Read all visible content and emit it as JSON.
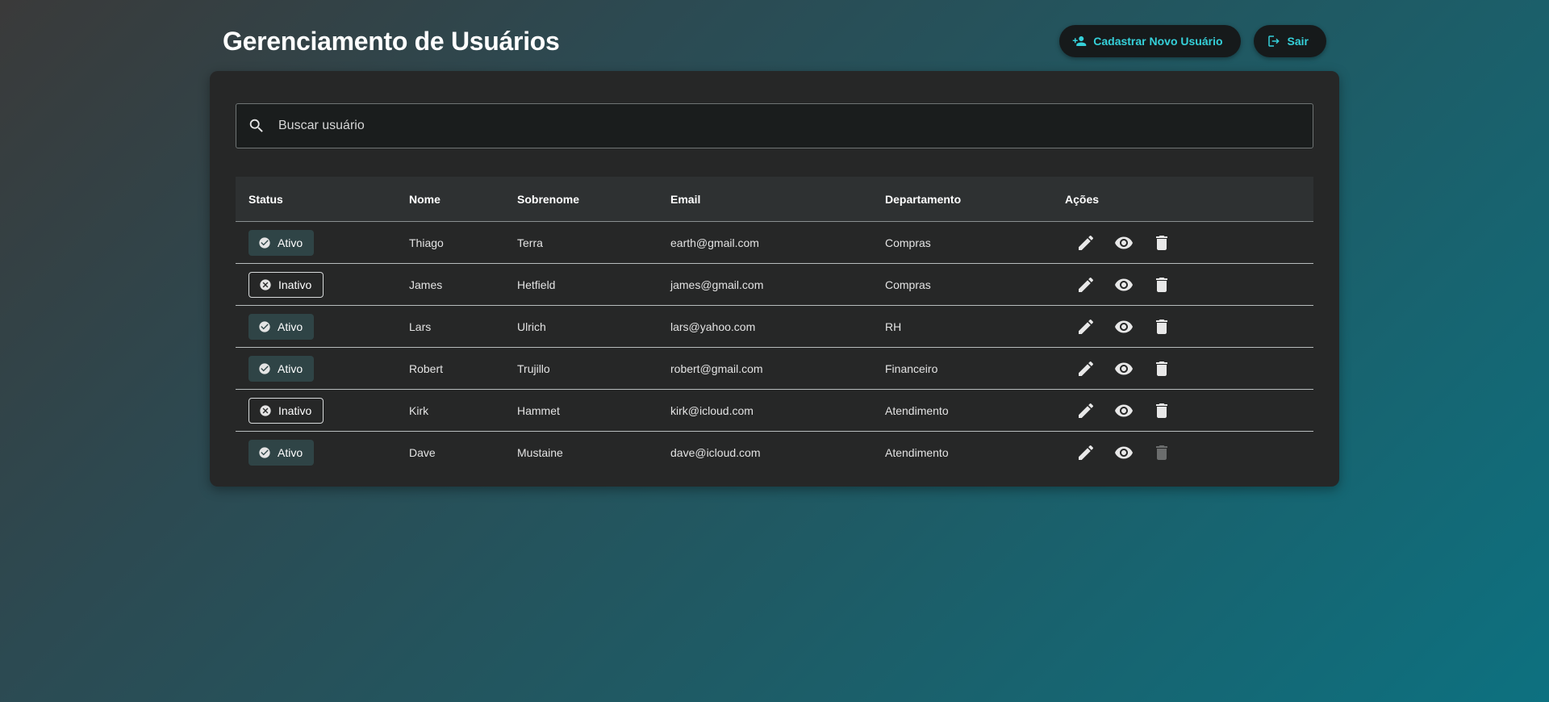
{
  "header": {
    "title": "Gerenciamento de Usuários",
    "register_label": "Cadastrar Novo Usuário",
    "logout_label": "Sair"
  },
  "search": {
    "placeholder": "Buscar usuário",
    "value": ""
  },
  "table": {
    "columns": [
      "Status",
      "Nome",
      "Sobrenome",
      "Email",
      "Departamento",
      "Ações"
    ],
    "rows": [
      {
        "status": "Ativo",
        "nome": "Thiago",
        "sobrenome": "Terra",
        "email": "earth@gmail.com",
        "departamento": "Compras",
        "delete_enabled": true
      },
      {
        "status": "Inativo",
        "nome": "James",
        "sobrenome": "Hetfield",
        "email": "james@gmail.com",
        "departamento": "Compras",
        "delete_enabled": true
      },
      {
        "status": "Ativo",
        "nome": "Lars",
        "sobrenome": "Ulrich",
        "email": "lars@yahoo.com",
        "departamento": "RH",
        "delete_enabled": true
      },
      {
        "status": "Ativo",
        "nome": "Robert",
        "sobrenome": "Trujillo",
        "email": "robert@gmail.com",
        "departamento": "Financeiro",
        "delete_enabled": true
      },
      {
        "status": "Inativo",
        "nome": "Kirk",
        "sobrenome": "Hammet",
        "email": "kirk@icloud.com",
        "departamento": "Atendimento",
        "delete_enabled": true
      },
      {
        "status": "Ativo",
        "nome": "Dave",
        "sobrenome": "Mustaine",
        "email": "dave@icloud.com",
        "departamento": "Atendimento",
        "delete_enabled": false
      }
    ]
  },
  "icons": {
    "register": "person-add-icon",
    "logout": "logout-icon",
    "search": "search-icon",
    "active": "check-circle-icon",
    "inactive": "cancel-circle-icon",
    "edit": "pencil-icon",
    "view": "eye-icon",
    "delete": "trash-icon"
  },
  "colors": {
    "accent": "#35d0d9",
    "card": "#262727",
    "active_chip": "#2f4446",
    "disabled_icon": "#6b6d6d"
  }
}
